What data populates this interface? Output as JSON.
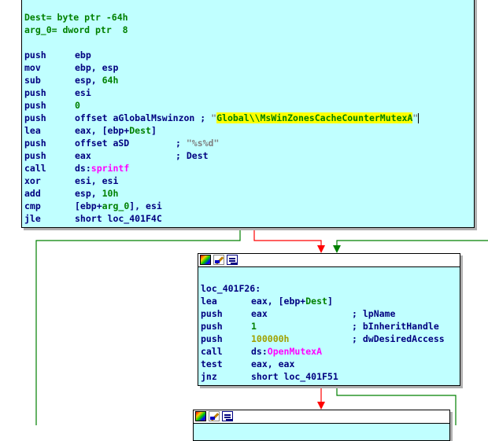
{
  "colors": {
    "node_bg": "#c0ffff",
    "text": "#000080",
    "green_text": "#008000",
    "hex_number": "#a0a000",
    "api_name": "#ff00ff",
    "string_highlight": "#ffff00",
    "edge_true": "#008000",
    "edge_false": "#ff0000",
    "edge_plain": "#008000"
  },
  "node1": {
    "var_dest": "Dest= byte ptr -64h",
    "var_arg0": "arg_0= dword ptr  8",
    "lines": [
      {
        "mn": "push",
        "op": "ebp"
      },
      {
        "mn": "mov",
        "op": "ebp, esp"
      },
      {
        "mn": "sub",
        "op": "esp, 64h"
      },
      {
        "mn": "push",
        "op": "esi"
      },
      {
        "mn": "push",
        "op": "0"
      },
      {
        "mn": "push",
        "op": "offset aGlobalMswinzon ; \"Global\\\\MsWinZonesCacheCounterMutexA\""
      },
      {
        "mn": "lea",
        "op": "eax, [ebp+Dest]"
      },
      {
        "mn": "push",
        "op": "offset aSD      ; \"%s%d\""
      },
      {
        "mn": "push",
        "op": "eax             ; Dest"
      },
      {
        "mn": "call",
        "op": "ds:sprintf"
      },
      {
        "mn": "xor",
        "op": "esi, esi"
      },
      {
        "mn": "add",
        "op": "esp, 10h"
      },
      {
        "mn": "cmp",
        "op": "[ebp+arg_0], esi"
      },
      {
        "mn": "jle",
        "op": "short loc_401F4C"
      }
    ],
    "parts": {
      "push_imm": "0",
      "sub_imm": "64h",
      "add_imm": "10h",
      "offset_kw": "offset",
      "global_sym": "aGlobalMswinzon",
      "semicolon": ";",
      "quote": "\"",
      "mutex_string": "Global\\\\MsWinZonesCacheCounterMutexA",
      "lea_ops_pre": "eax, [ebp+",
      "lea_ops_var": "Dest",
      "lea_ops_post": "]",
      "asd_sym": "offset aSD",
      "fmt_string": "\"%s%d\"",
      "dest_comment": "; Dest",
      "ds_prefix": "ds:",
      "sprintf": "sprintf",
      "cmp_pre": "[ebp+",
      "cmp_var": "arg_0",
      "cmp_post": "], esi",
      "jle_target": "short loc_401F4C"
    }
  },
  "node2": {
    "label": "loc_401F26:",
    "lines": [
      {
        "mn": "lea",
        "op": "eax, [ebp+Dest]"
      },
      {
        "mn": "push",
        "op": "eax",
        "comment": "; lpName"
      },
      {
        "mn": "push",
        "op": "1",
        "comment": "; bInheritHandle"
      },
      {
        "mn": "push",
        "op": "100000h",
        "comment": "; dwDesiredAccess"
      },
      {
        "mn": "call",
        "op": "ds:OpenMutexA"
      },
      {
        "mn": "test",
        "op": "eax, eax"
      },
      {
        "mn": "jnz",
        "op": "short loc_401F51"
      }
    ],
    "parts": {
      "ds_prefix": "ds:",
      "open_mutex": "OpenMutexA"
    }
  }
}
